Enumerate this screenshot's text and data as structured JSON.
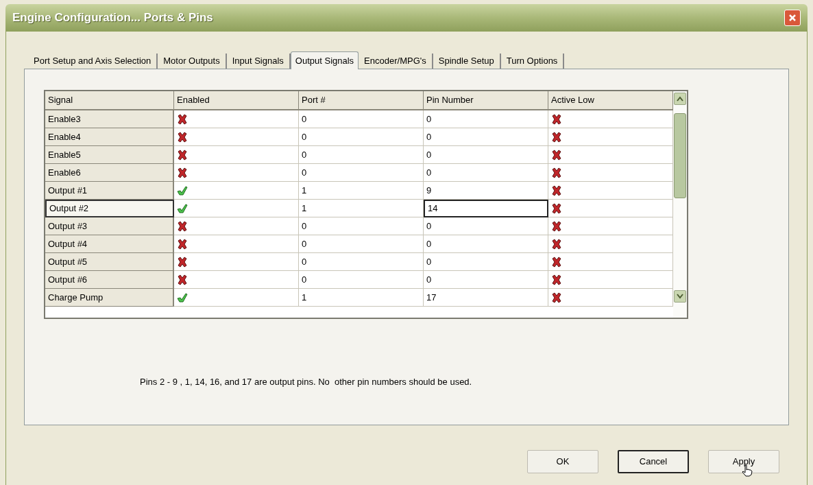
{
  "window": {
    "title": "Engine Configuration... Ports & Pins"
  },
  "tabs": [
    {
      "label": "Port Setup and Axis Selection",
      "selected": false
    },
    {
      "label": "Motor Outputs",
      "selected": false
    },
    {
      "label": "Input Signals",
      "selected": false
    },
    {
      "label": "Output Signals",
      "selected": true
    },
    {
      "label": "Encoder/MPG's",
      "selected": false
    },
    {
      "label": "Spindle Setup",
      "selected": false
    },
    {
      "label": "Turn Options",
      "selected": false
    }
  ],
  "table": {
    "columns": [
      "Signal",
      "Enabled",
      "Port #",
      "Pin Number",
      "Active Low"
    ],
    "rows": [
      {
        "signal": "Enable3",
        "enabled": false,
        "port": "0",
        "pin": "0",
        "active_low": false,
        "selected": false
      },
      {
        "signal": "Enable4",
        "enabled": false,
        "port": "0",
        "pin": "0",
        "active_low": false,
        "selected": false
      },
      {
        "signal": "Enable5",
        "enabled": false,
        "port": "0",
        "pin": "0",
        "active_low": false,
        "selected": false
      },
      {
        "signal": "Enable6",
        "enabled": false,
        "port": "0",
        "pin": "0",
        "active_low": false,
        "selected": false
      },
      {
        "signal": "Output #1",
        "enabled": true,
        "port": "1",
        "pin": "9",
        "active_low": false,
        "selected": false
      },
      {
        "signal": "Output #2",
        "enabled": true,
        "port": "1",
        "pin": "14",
        "active_low": false,
        "selected": true
      },
      {
        "signal": "Output #3",
        "enabled": false,
        "port": "0",
        "pin": "0",
        "active_low": false,
        "selected": false
      },
      {
        "signal": "Output #4",
        "enabled": false,
        "port": "0",
        "pin": "0",
        "active_low": false,
        "selected": false
      },
      {
        "signal": "Output #5",
        "enabled": false,
        "port": "0",
        "pin": "0",
        "active_low": false,
        "selected": false
      },
      {
        "signal": "Output #6",
        "enabled": false,
        "port": "0",
        "pin": "0",
        "active_low": false,
        "selected": false
      },
      {
        "signal": "Charge Pump",
        "enabled": true,
        "port": "1",
        "pin": "17",
        "active_low": false,
        "selected": false
      }
    ]
  },
  "note": "Pins 2 - 9 , 1, 14, 16, and 17 are output pins. No  other pin numbers should be used.",
  "buttons": [
    "OK",
    "Cancel",
    "Apply"
  ]
}
